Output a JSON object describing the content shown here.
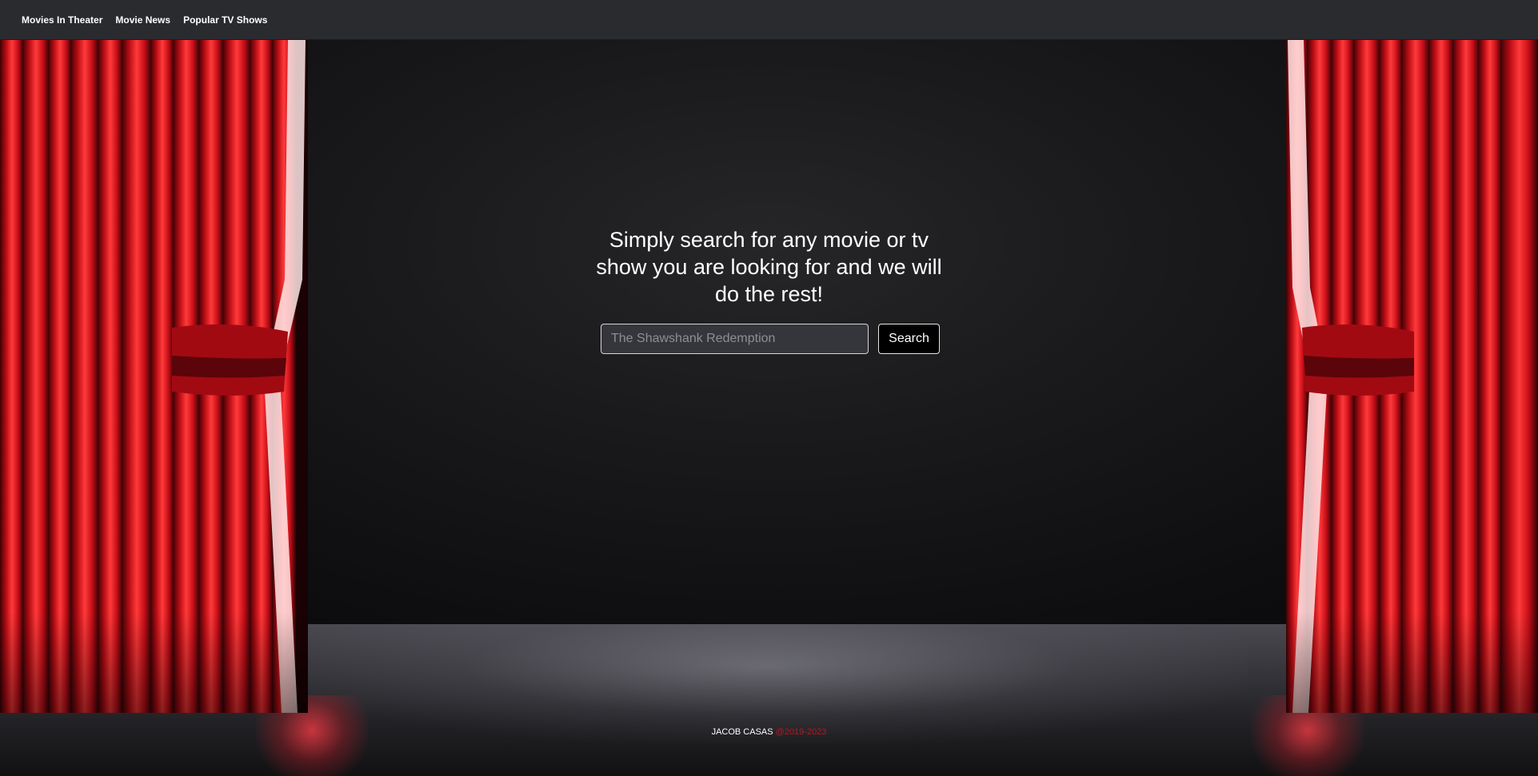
{
  "nav": {
    "links": [
      {
        "label": "Movies In Theater"
      },
      {
        "label": "Movie News"
      },
      {
        "label": "Popular TV Shows"
      }
    ]
  },
  "hero": {
    "title": "Simply search for any movie or tv show you are looking for and we will do the rest!"
  },
  "search": {
    "placeholder": "The Shawshank Redemption",
    "value": "",
    "button_label": "Search"
  },
  "footer": {
    "name": "JACOB CASAS",
    "years": "@2019-2023"
  },
  "colors": {
    "navbar_bg": "#2a2b2f",
    "curtain_red": "#e4161f",
    "footer_accent": "#c0121c",
    "input_bg": "#34363b"
  },
  "icons": {
    "curtain": "stage-curtain-icon"
  }
}
